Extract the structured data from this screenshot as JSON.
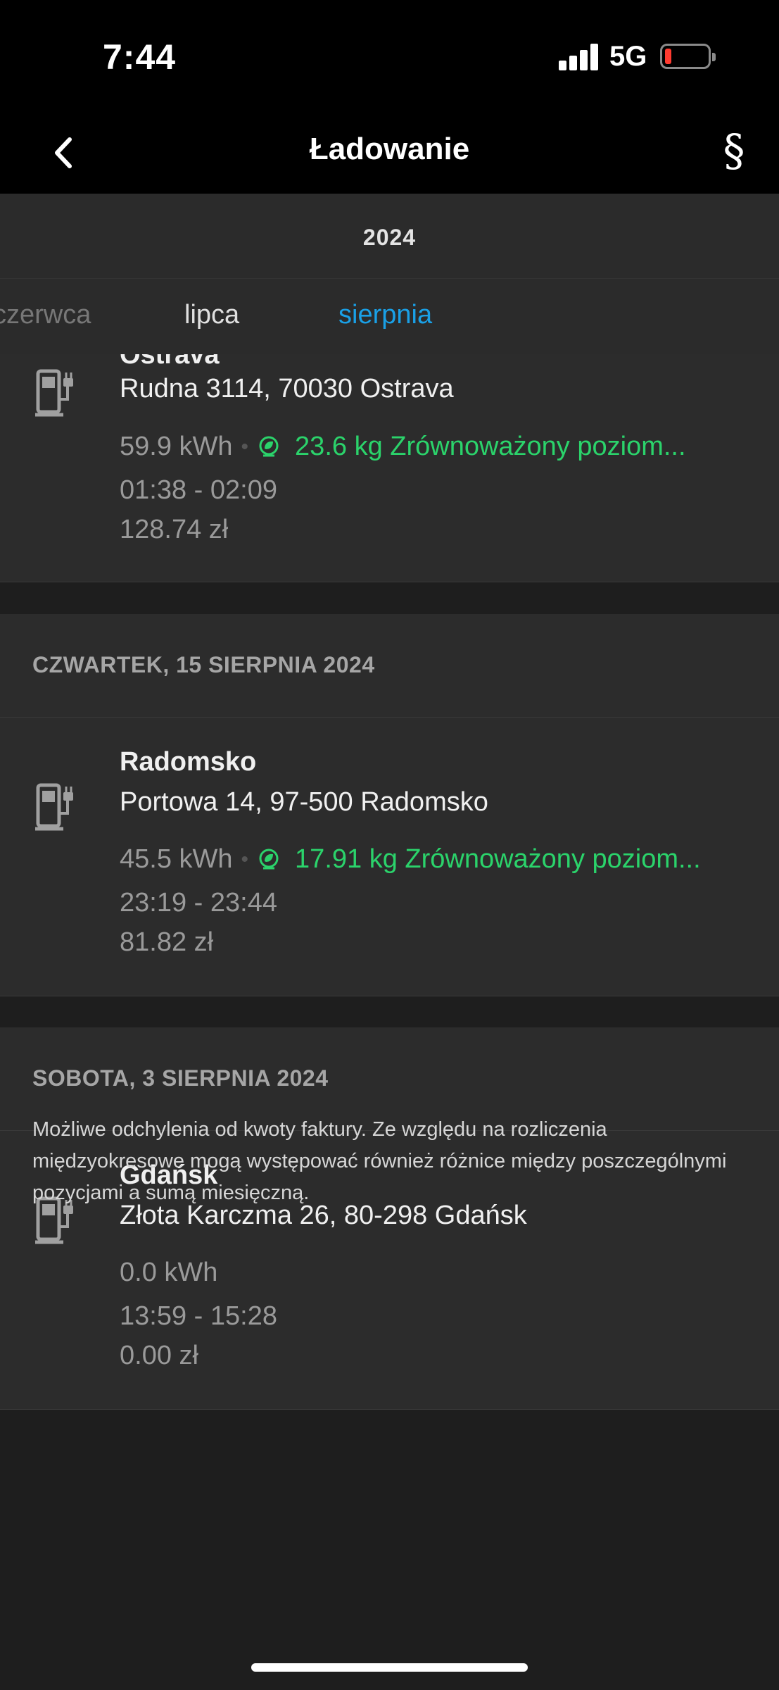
{
  "status_bar": {
    "time": "7:44",
    "network": "5G",
    "battery_color": "#ff3b30"
  },
  "header": {
    "title": "Ładowanie",
    "legal_symbol": "§"
  },
  "year": "2024",
  "months": [
    {
      "label": "czerwca",
      "state": "partial"
    },
    {
      "label": "lipca",
      "state": "normal"
    },
    {
      "label": "sierpnia",
      "state": "active"
    }
  ],
  "sessions": [
    {
      "date": "",
      "location": "Ostrava",
      "address": "Rudna 3114, 70030 Ostrava",
      "energy": "59.9 kWh",
      "separator": "•",
      "eco": "23.6 kg Zrównoważony poziom...",
      "time": "01:38 - 02:09",
      "cost": "128.74 zł"
    },
    {
      "date": "CZWARTEK, 15 SIERPNIA 2024",
      "location": "Radomsko",
      "address": "Portowa 14, 97-500 Radomsko",
      "energy": "45.5 kWh",
      "separator": "•",
      "eco": "17.91 kg Zrównoważony poziom...",
      "time": "23:19 - 23:44",
      "cost": "81.82 zł"
    },
    {
      "date": "SOBOTA, 3 SIERPNIA 2024",
      "location": "Gdańsk",
      "address": "Złota Karczma 26, 80-298 Gdańsk",
      "energy": "0.0 kWh",
      "time": "13:59 - 15:28",
      "cost": "0.00 zł"
    }
  ],
  "disclaimer": "Możliwe odchylenia od kwoty faktury. Ze względu na rozliczenia międzyokresowe mogą występować również różnice między poszczególnymi pozycjami a sumą miesięczną.",
  "icons": {
    "charger": "ev-charger-icon",
    "eco": "eco-leaf-icon",
    "back": "chevron-left-icon"
  },
  "colors": {
    "accent": "#1aa0e6",
    "eco_green": "#2bd36b"
  }
}
